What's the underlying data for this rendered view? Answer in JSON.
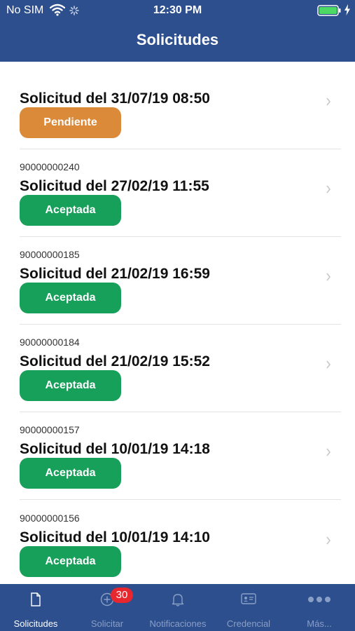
{
  "status_bar": {
    "carrier": "No SIM",
    "time": "12:30 PM"
  },
  "nav": {
    "title": "Solicitudes"
  },
  "colors": {
    "header": "#2d4f8d",
    "pending": "#db8a3a",
    "accepted": "#17a05a",
    "badge": "#e8262e"
  },
  "requests": [
    {
      "id": "",
      "title": "Solicitud del 31/07/19 08:50",
      "status": "Pendiente",
      "status_key": "pending"
    },
    {
      "id": "90000000240",
      "title": "Solicitud del 27/02/19 11:55",
      "status": "Aceptada",
      "status_key": "accepted"
    },
    {
      "id": "90000000185",
      "title": "Solicitud del 21/02/19 16:59",
      "status": "Aceptada",
      "status_key": "accepted"
    },
    {
      "id": "90000000184",
      "title": "Solicitud del 21/02/19 15:52",
      "status": "Aceptada",
      "status_key": "accepted"
    },
    {
      "id": "90000000157",
      "title": "Solicitud del 10/01/19 14:18",
      "status": "Aceptada",
      "status_key": "accepted"
    },
    {
      "id": "90000000156",
      "title": "Solicitud del 10/01/19 14:10",
      "status": "Aceptada",
      "status_key": "accepted"
    }
  ],
  "tabbar": {
    "tabs": [
      {
        "label": "Solicitudes",
        "icon": "document-icon",
        "active": true
      },
      {
        "label": "Solicitar",
        "icon": "add-circle-icon",
        "badge": "30"
      },
      {
        "label": "Notificaciones",
        "icon": "bell-icon"
      },
      {
        "label": "Credencial",
        "icon": "id-card-icon"
      },
      {
        "label": "Más...",
        "icon": "more-icon"
      }
    ]
  }
}
